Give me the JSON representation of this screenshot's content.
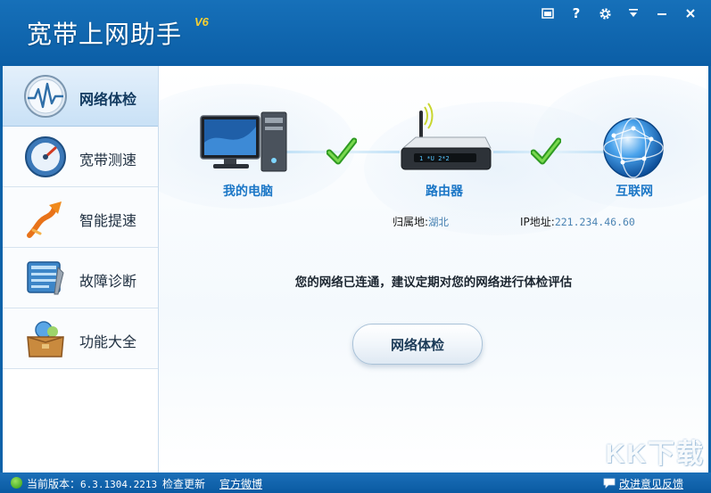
{
  "window": {
    "title": "宽带上网助手",
    "version": "V6",
    "controls": [
      "skin",
      "help",
      "settings",
      "menu",
      "minimize",
      "close"
    ]
  },
  "sidebar": {
    "items": [
      {
        "label": "网络体检",
        "icon": "stethoscope-icon",
        "active": true
      },
      {
        "label": "宽带测速",
        "icon": "speedometer-icon",
        "active": false
      },
      {
        "label": "智能提速",
        "icon": "rocket-arrow-icon",
        "active": false
      },
      {
        "label": "故障诊断",
        "icon": "wrench-diagnosis-icon",
        "active": false
      },
      {
        "label": "功能大全",
        "icon": "toolbox-icon",
        "active": false
      }
    ]
  },
  "diagram": {
    "nodes": [
      {
        "label": "我的电脑",
        "icon": "computer-icon"
      },
      {
        "label": "路由器",
        "icon": "router-icon"
      },
      {
        "label": "互联网",
        "icon": "globe-icon"
      }
    ],
    "router_display": "1  *U 2*2",
    "region_label": "归属地:",
    "region_value": "湖北",
    "ip_label": "IP地址:",
    "ip_value": "221.234.46.60"
  },
  "main": {
    "status_message": "您的网络已连通，建议定期对您的网络进行体检评估",
    "check_button": "网络体检",
    "watermark": "KK下载"
  },
  "statusbar": {
    "version_label": "当前版本：",
    "version_value": "6.3.1304.2213",
    "check_update": "检查更新",
    "weibo": "官方微博",
    "feedback": "改进意见反馈"
  },
  "colors": {
    "title_blue": "#0b5ea6",
    "accent_blue": "#1a76c6",
    "version_yellow": "#f8d030",
    "check_green": "#3cae2c"
  }
}
